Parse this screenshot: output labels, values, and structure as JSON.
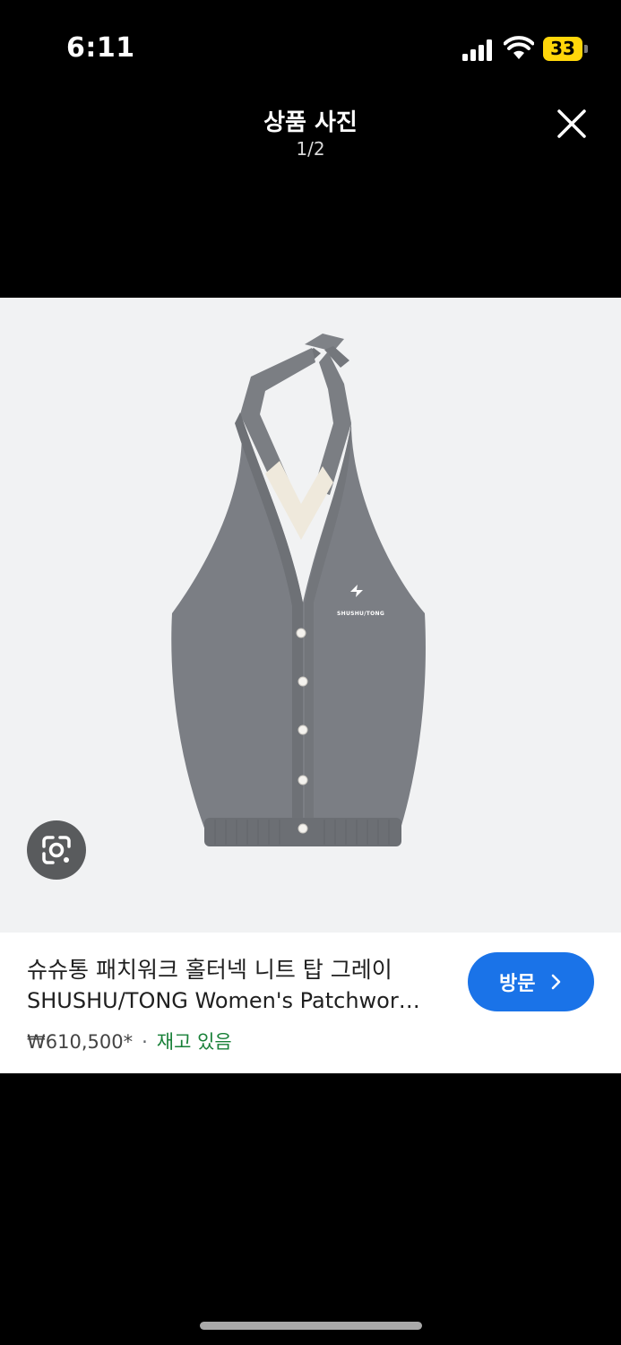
{
  "status_bar": {
    "time": "6:11",
    "battery_level": "33",
    "battery_color": "#ffd60a",
    "icons": [
      "cellular-signal-icon",
      "wifi-icon",
      "battery-icon"
    ]
  },
  "viewer": {
    "title": "상품 사진",
    "counter": "1/2",
    "close_icon": "close-icon"
  },
  "image": {
    "description_icon": "google-lens-icon",
    "logo_text": "SHUSHU/TONG"
  },
  "product": {
    "title": "슈슈통 패치워크 홀터넥 니트 탑 그레이",
    "subtitle": "SHUSHU/TONG Women's Patchwor…",
    "price": "₩610,500*",
    "separator": "·",
    "availability": "재고 있음",
    "availability_color": "#188038",
    "visit_label": "방문",
    "visit_color": "#1a73e8"
  }
}
